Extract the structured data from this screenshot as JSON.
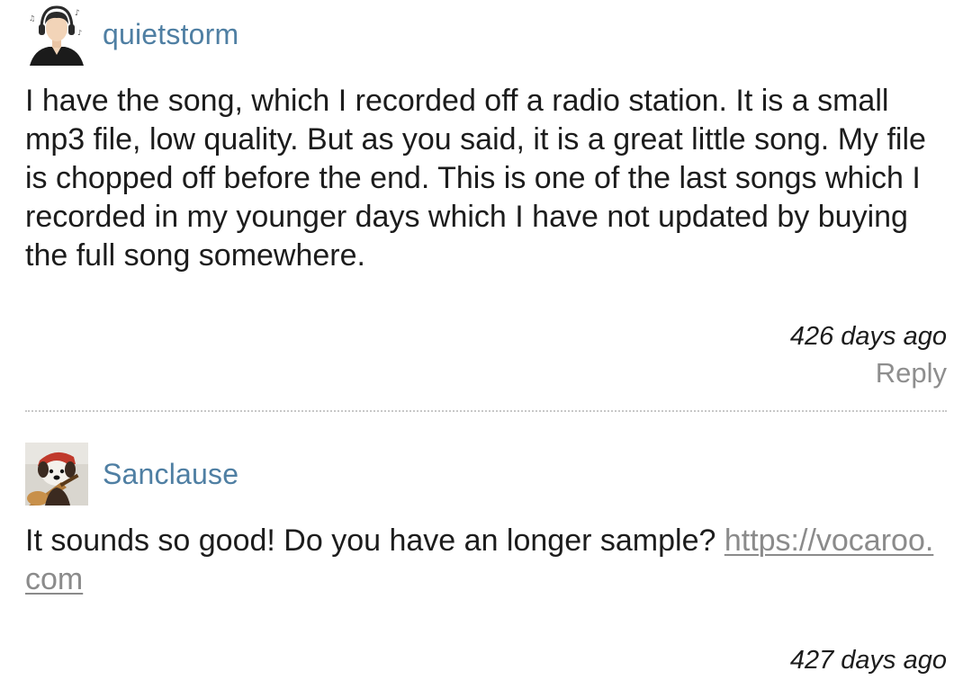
{
  "comments": [
    {
      "avatar_icon": "headphones-man-avatar",
      "username": "quietstorm",
      "body": "I have the song, which I recorded off a radio station. It is a small mp3 file, low quality. But as you said, it is a great little song. My file is chopped off before the end. This is one of the last songs which I recorded in my younger days which I have not updated by buying the full song somewhere.",
      "timestamp": "426 days ago",
      "reply_label": "Reply"
    },
    {
      "avatar_icon": "dog-with-guitar-avatar",
      "username": "Sanclause",
      "body_text": "It sounds so good! Do you have an longer sample? ",
      "link_text": "https://vocaroo.com",
      "timestamp": "427 days ago"
    }
  ],
  "colors": {
    "username": "#4f7fa3",
    "reply": "#8e8e8e",
    "link": "#8b8b8b",
    "divider": "#c8c8c8"
  }
}
